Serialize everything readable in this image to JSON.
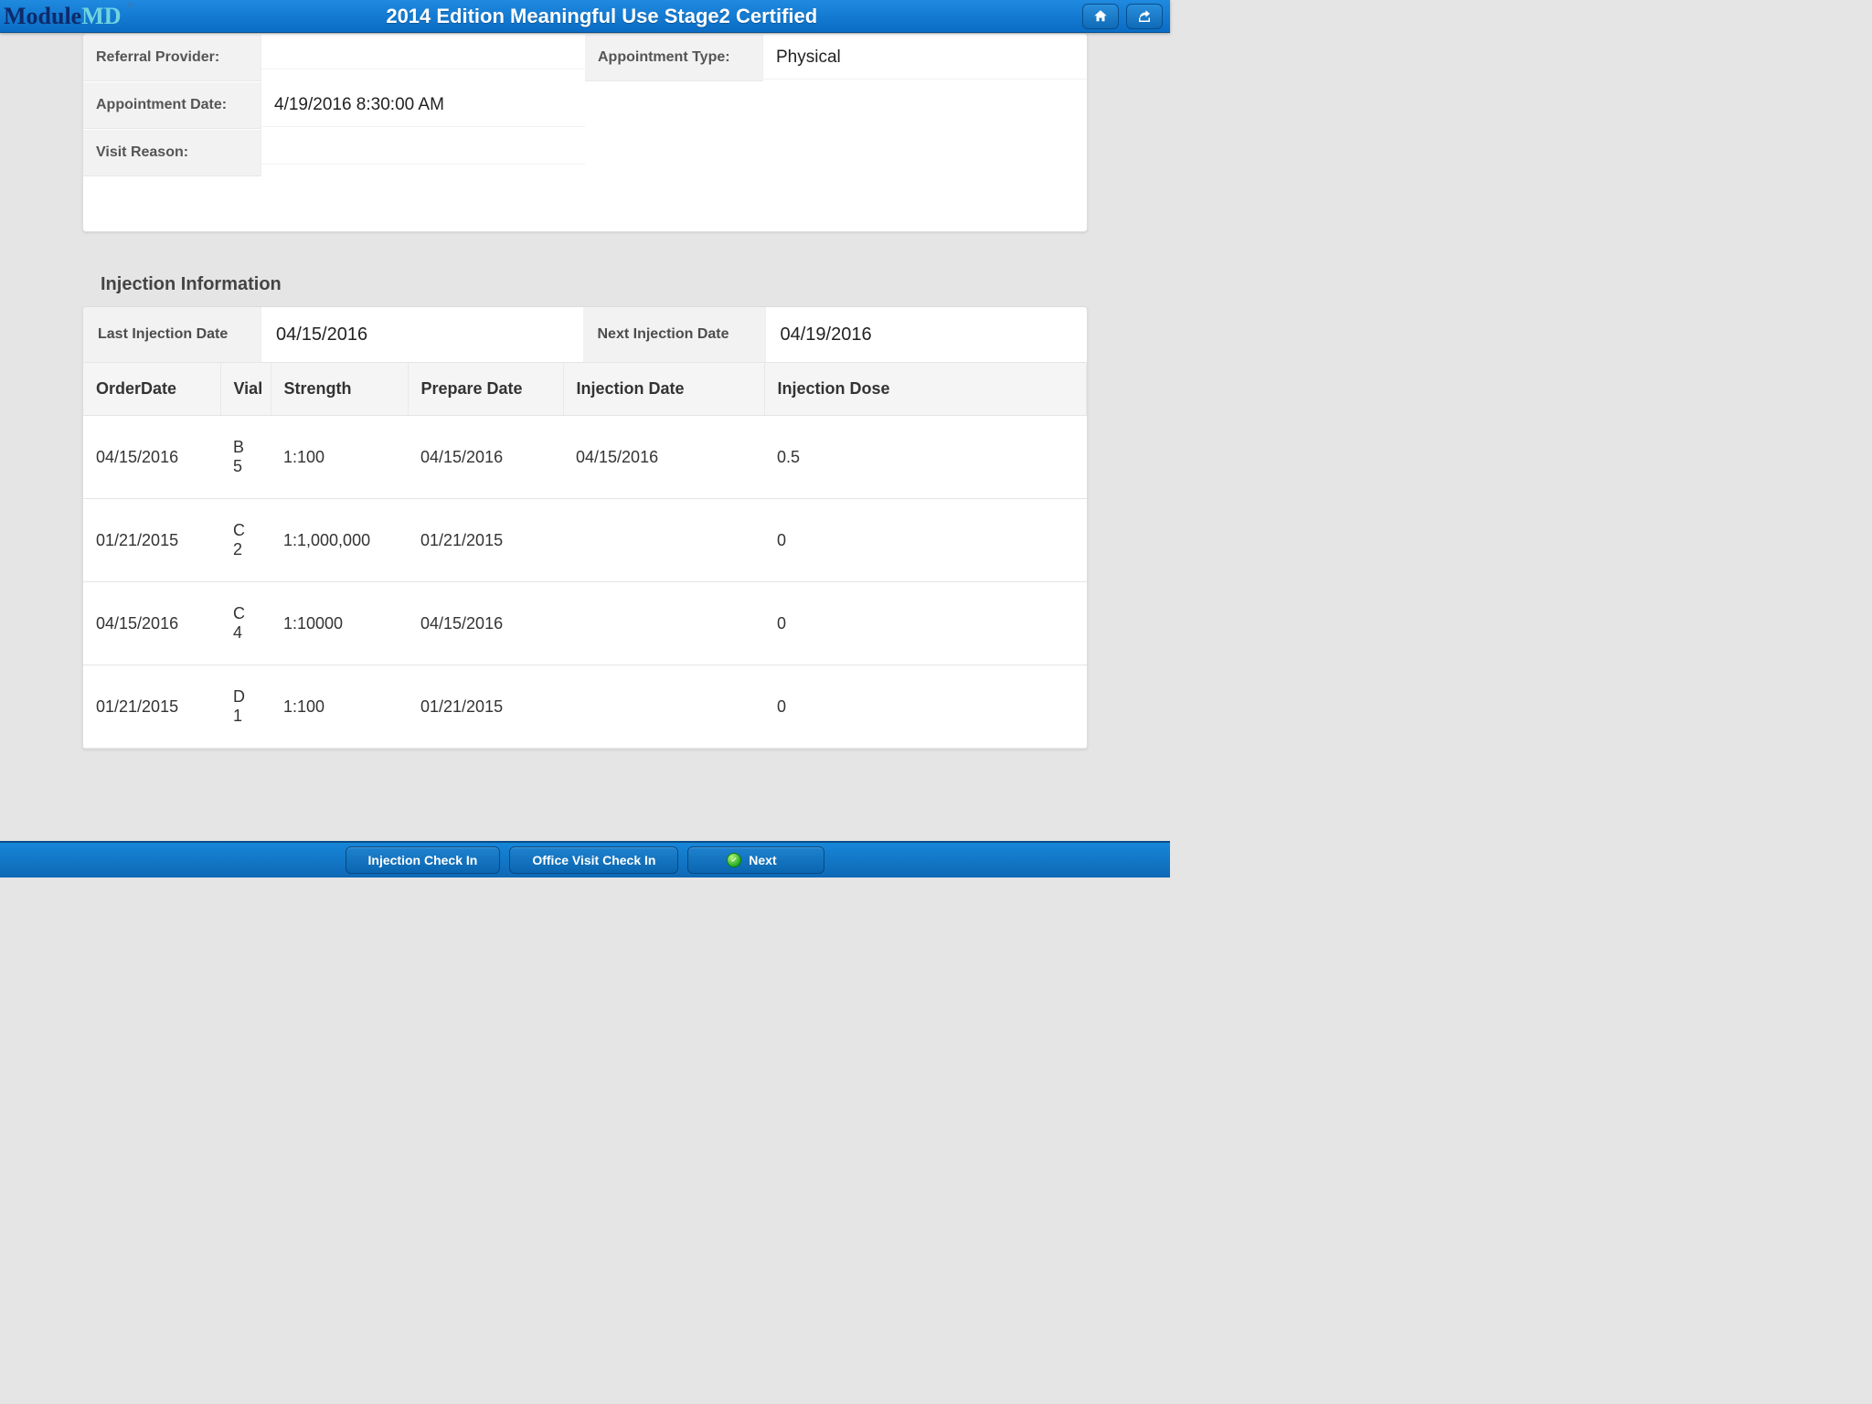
{
  "header": {
    "logo_part1": "Module",
    "logo_part2": "MD",
    "logo_reg": "®",
    "title": "2014 Edition Meaningful Use Stage2 Certified"
  },
  "appt": {
    "referral_provider_label": "Referral Provider:",
    "referral_provider_value": "",
    "appointment_type_label": "Appointment Type:",
    "appointment_type_value": "Physical",
    "appointment_date_label": "Appointment Date:",
    "appointment_date_value": "4/19/2016 8:30:00 AM",
    "visit_reason_label": "Visit Reason:",
    "visit_reason_value": ""
  },
  "injection": {
    "section_title": "Injection Information",
    "last_label": "Last Injection Date",
    "last_value": "04/15/2016",
    "next_label": "Next Injection Date",
    "next_value": "04/19/2016",
    "columns": {
      "order": "OrderDate",
      "vial": "Vial",
      "strength": "Strength",
      "prepare": "Prepare Date",
      "injdate": "Injection Date",
      "dose": "Injection Dose"
    },
    "rows": [
      {
        "order": "04/15/2016",
        "vial": "B 5",
        "strength": "1:100",
        "prepare": "04/15/2016",
        "injdate": "04/15/2016",
        "dose": "0.5"
      },
      {
        "order": "01/21/2015",
        "vial": "C 2",
        "strength": "1:1,000,000",
        "prepare": "01/21/2015",
        "injdate": "",
        "dose": "0"
      },
      {
        "order": "04/15/2016",
        "vial": "C 4",
        "strength": "1:10000",
        "prepare": "04/15/2016",
        "injdate": "",
        "dose": "0"
      },
      {
        "order": "01/21/2015",
        "vial": "D 1",
        "strength": "1:100",
        "prepare": "01/21/2015",
        "injdate": "",
        "dose": "0"
      }
    ]
  },
  "footer": {
    "btn_injection_checkin": "Injection Check In",
    "btn_office_checkin": "Office Visit Check In",
    "btn_next": "Next"
  }
}
